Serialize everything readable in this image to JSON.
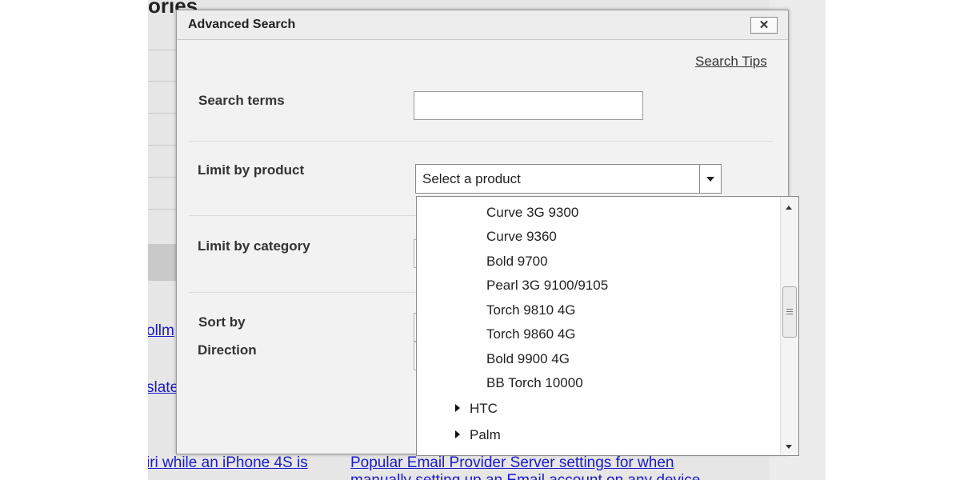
{
  "background": {
    "title": "ories",
    "links": [
      "ollm",
      "slate",
      "iri while an iPhone 4S is",
      "Popular Email Provider Server settings for when",
      "manually setting up an Email account on any device"
    ]
  },
  "dialog": {
    "title": "Advanced Search",
    "close_label": "✕",
    "search_tips": "Search Tips",
    "labels": {
      "search_terms": "Search terms",
      "limit_product": "Limit by product",
      "limit_category": "Limit by category",
      "sort_by": "Sort by",
      "direction": "Direction"
    },
    "search_input": {
      "value": "",
      "placeholder": ""
    },
    "product_select": {
      "selected": "Select a product"
    },
    "product_dropdown": {
      "items": [
        "Curve 3G 9300",
        "Curve 9360",
        "Bold 9700",
        "Pearl 3G 9100/9105",
        "Torch 9810 4G",
        "Torch 9860 4G",
        "Bold 9900 4G",
        "BB Torch 10000"
      ],
      "groups": [
        "HTC",
        "Palm"
      ],
      "scroll_position": 0.42
    }
  }
}
